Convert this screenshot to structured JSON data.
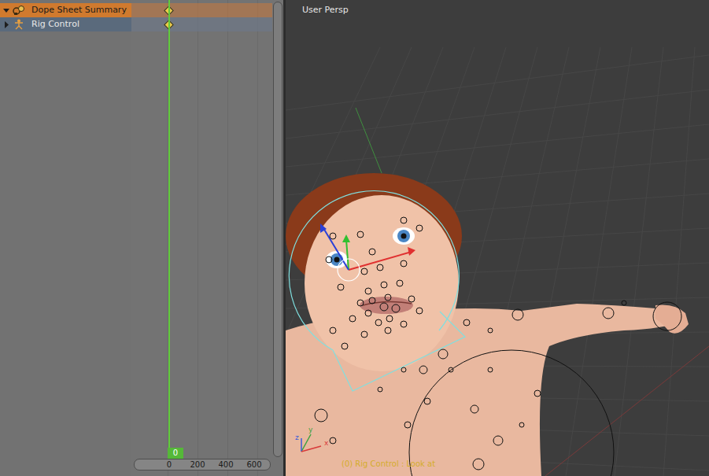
{
  "dope_sheet": {
    "channels": [
      {
        "name": "Dope Sheet Summary",
        "kind": "summary",
        "expanded": true,
        "selected": true,
        "keyframes": [
          0
        ]
      },
      {
        "name": "Rig Control",
        "kind": "object",
        "expanded": false,
        "selected": false,
        "keyframes": [
          0
        ]
      }
    ],
    "current_frame": "0",
    "ruler": [
      "0",
      "200",
      "400",
      "600"
    ]
  },
  "viewport": {
    "view": "User Persp",
    "status": "(0) Rig Control : Look at",
    "axes": [
      {
        "label": "y",
        "color": "#3ea23e"
      },
      {
        "label": "z",
        "color": "#3a5bd8"
      },
      {
        "label": "x",
        "color": "#d83a3a"
      }
    ]
  }
}
